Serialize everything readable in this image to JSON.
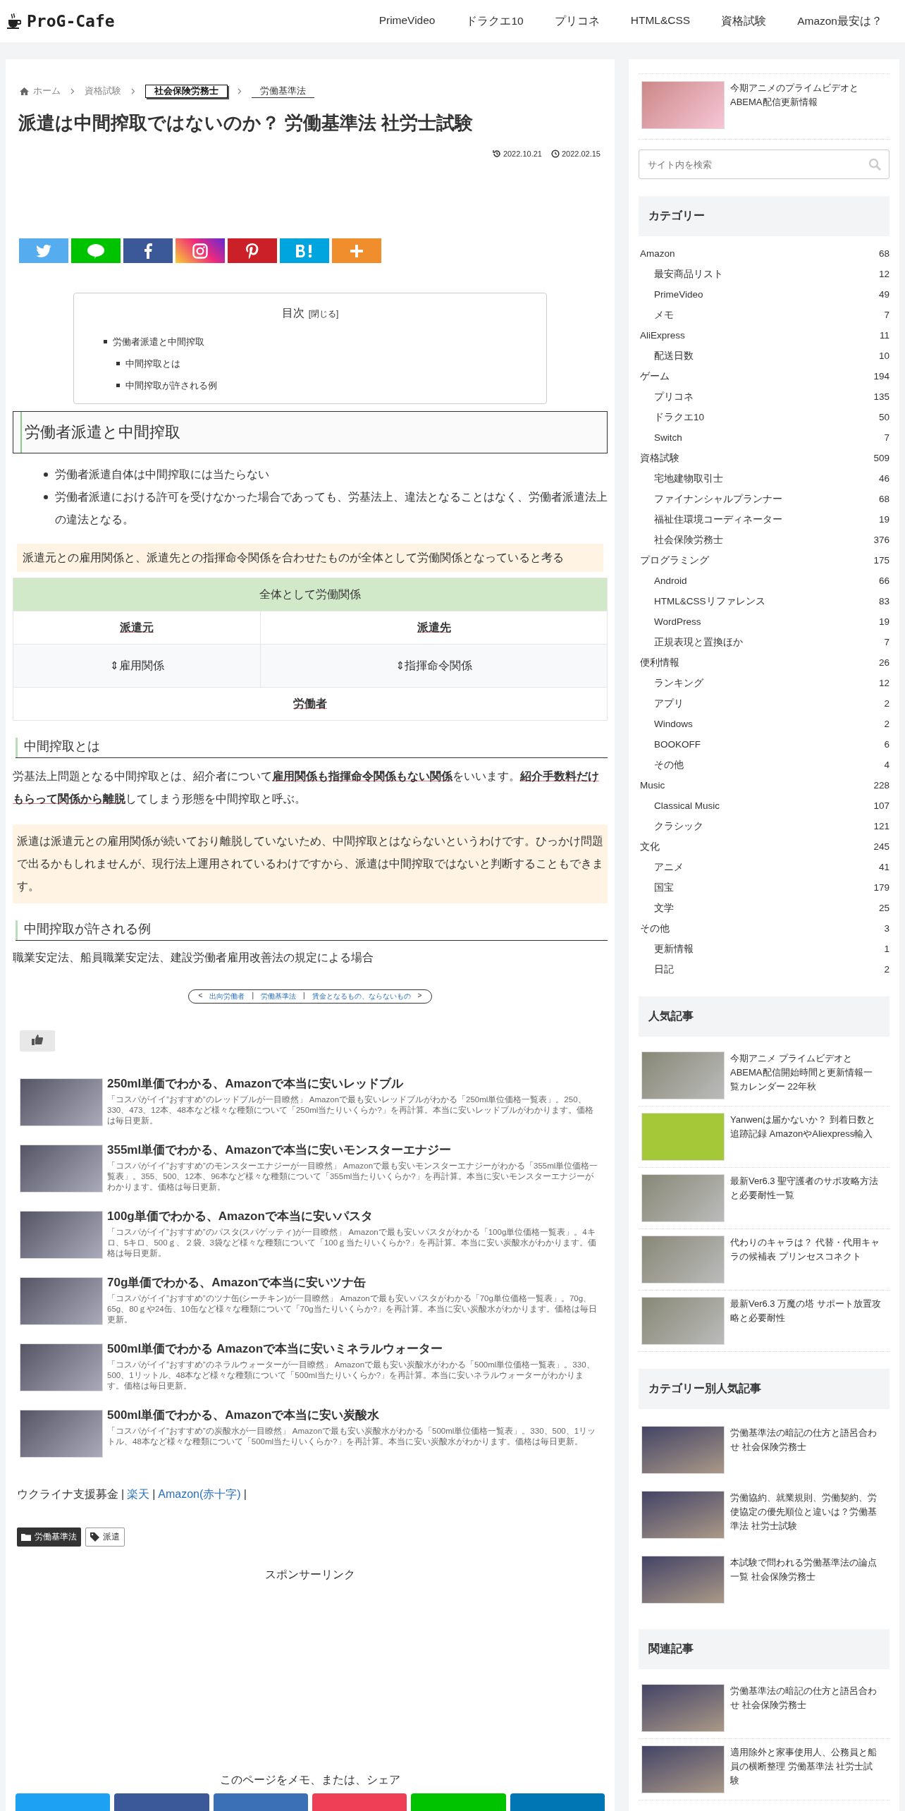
{
  "header": {
    "logo": "ProG-Cafe",
    "nav": [
      "PrimeVideo",
      "ドラクエ10",
      "プリコネ",
      "HTML&CSS",
      "資格試験",
      "Amazon最安は？"
    ]
  },
  "breadcrumb": [
    {
      "label": "ホーム",
      "kind": "home"
    },
    {
      "label": "資格試験",
      "kind": "link"
    },
    {
      "label": "社会保険労務士",
      "kind": "boxed"
    },
    {
      "label": "労働基準法",
      "kind": "current"
    }
  ],
  "article": {
    "title": "派遣は中間搾取ではないのか？ 労働基準法 社労士試験",
    "updated": "2022.10.21",
    "published": "2022.02.15",
    "share": [
      {
        "kind": "twitter"
      },
      {
        "kind": "line"
      },
      {
        "kind": "facebook"
      },
      {
        "kind": "instagram"
      },
      {
        "kind": "pinterest"
      },
      {
        "kind": "hatena"
      },
      {
        "kind": "more"
      }
    ],
    "toc": {
      "title": "目次",
      "toggle": "[閉じる]",
      "items": [
        {
          "label": "労働者派遣と中間搾取",
          "children": [
            {
              "label": "中間搾取とは"
            },
            {
              "label": "中間搾取が許される例"
            }
          ]
        }
      ]
    },
    "h2": "労働者派遣と中間搾取",
    "bullets": [
      "労働者派遣自体は中間搾取には当たらない",
      "労働者派遣における許可を受けなかった場合であっても、労基法上、違法となることはなく、労働者派遣法上の違法となる。"
    ],
    "highlight": "派遣元との雇用関係と、派遣先との指揮命令関係を合わせたものが全体として労働関係となっていると考る",
    "table": {
      "header": "全体として労働関係",
      "parties": [
        "派遣元",
        "派遣先"
      ],
      "relations": [
        "⇕雇用関係",
        "⇕指揮命令関係"
      ],
      "bottom": "労働者"
    },
    "h3a": "中間搾取とは",
    "para1": "労基法上問題となる中間搾取とは、紹介者について**雇用関係も指揮命令関係もない関係**をいいます。**紹介手数料だけもらって関係から離脱**してしまう形態を中間搾取と呼ぶ。",
    "callout": "派遣は派遣元との雇用関係が続いており離脱していないため、中間搾取とはならないというわけです。ひっかけ問題で出るかもしれませんが、現行法上運用されているわけですから、派遣は中間搾取ではないと判断することもできます。",
    "h3b": "中間搾取が許される例",
    "para2": "職業安定法、船員職業安定法、建設労働者雇用改善法の規定による場合",
    "pager": {
      "prev_mark": "<",
      "prev": "出向労働者",
      "sep1": "|",
      "current": "労働基準法",
      "sep2": "|",
      "next": "賃金となるもの、ならないもの",
      "next_mark": ">"
    },
    "related": [
      {
        "title": "250ml単価でわかる、Amazonで本当に安いレッドブル",
        "desc": "「コスパがイイ”おすすめ”のレッドブルが一目瞭然」 Amazonで最も安いレッドブルがわかる「250ml単位価格一覧表」。250、330、473、12本、48本など様々な種類について「250ml当たりいくらか?」を再計算。本当に安いレッドブルがわかります。価格は毎日更新。"
      },
      {
        "title": "355ml単価でわかる、Amazonで本当に安いモンスターエナジー",
        "desc": "「コスパがイイ”おすすめ”のモンスターエナジーが一目瞭然」 Amazonで最も安いモンスターエナジーがわかる「355ml単位価格一覧表」。355、500、12本、96本など様々な種類について「355ml当たりいくらか?」を再計算。本当に安いモンスターエナジーがわかります。価格は毎日更新。"
      },
      {
        "title": "100g単価でわかる、Amazonで本当に安いパスタ",
        "desc": "「コスパがイイ”おすすめ”のパスタ(スパゲッティ)が一目瞭然」 Amazonで最も安いパスタがわかる「100g単位価格一覧表」。4キロ、5キロ、500ｇ、２袋、3袋など様々な種類について「100ｇ当たりいくらか?」を再計算。本当に安い炭酸水がわかります。価格は毎日更新。"
      },
      {
        "title": "70g単価でわかる、Amazonで本当に安いツナ缶",
        "desc": "「コスパがイイ”おすすめ”のツナ缶(シーチキン)が一目瞭然」 Amazonで最も安いパスタがわかる「70g単位価格一覧表」。70g、65g、80ｇや24缶、10缶など様々な種類について「70g当たりいくらか?」を再計算。本当に安い炭酸水がわかります。価格は毎日更新。"
      },
      {
        "title": "500ml単価でわかる Amazonで本当に安いミネラルウォーター",
        "desc": "「コスパがイイ”おすすめ”のネラルウォーターが一目瞭然」 Amazonで最も安い炭酸水がわかる「500ml単位価格一覧表」。330、500、1リットル、48本など様々な種類について「500ml当たりいくらか?」を再計算。本当に安いネラルウォーターがわかります。価格は毎日更新。"
      },
      {
        "title": "500ml単価でわかる、Amazonで本当に安い炭酸水",
        "desc": "「コスパがイイ”おすすめ”の炭酸水が一目瞭然」 Amazonで最も安い炭酸水がわかる「500ml単位価格一覧表」。330、500、1リットル、48本など様々な種類について「500ml当たりいくらか?」を再計算。本当に安い炭酸水がわかります。価格は毎日更新。"
      }
    ],
    "donation": {
      "label": "ウクライナ支援募金",
      "separator": "|",
      "links": [
        "楽天",
        "Amazon(赤十字)"
      ]
    },
    "tags": [
      {
        "label": "労働基準法",
        "kind": "category"
      },
      {
        "label": "派遣",
        "kind": "tag"
      }
    ],
    "sponsor": "スポンサーリンク",
    "share_heading": "このページをメモ、または、シェア",
    "bottom_share": [
      {
        "color": "#1da1f2"
      },
      {
        "color": "#3b5998"
      },
      {
        "color": "#3b6fb6"
      },
      {
        "color": "#ef3f56"
      },
      {
        "color": "#00c300"
      },
      {
        "color": "#0077b5"
      }
    ]
  },
  "sidebar": {
    "top_article": "今期アニメのプライムビデオとABEMA配信更新情報",
    "search": {
      "placeholder": "サイト内を検索"
    },
    "categories_title": "カテゴリー",
    "categories": [
      {
        "label": "Amazon",
        "count": "68",
        "children": [
          {
            "label": "最安商品リスト",
            "count": "12"
          },
          {
            "label": "PrimeVideo",
            "count": "49"
          },
          {
            "label": "メモ",
            "count": "7"
          }
        ]
      },
      {
        "label": "AliExpress",
        "count": "11",
        "children": [
          {
            "label": "配送日数",
            "count": "10"
          }
        ]
      },
      {
        "label": "ゲーム",
        "count": "194",
        "children": [
          {
            "label": "プリコネ",
            "count": "135"
          },
          {
            "label": "ドラクエ10",
            "count": "50"
          },
          {
            "label": "Switch",
            "count": "7"
          }
        ]
      },
      {
        "label": "資格試験",
        "count": "509",
        "children": [
          {
            "label": "宅地建物取引士",
            "count": "46"
          },
          {
            "label": "ファイナンシャルプランナー",
            "count": "68"
          },
          {
            "label": "福祉住環境コーディネーター",
            "count": "19"
          },
          {
            "label": "社会保険労務士",
            "count": "376"
          }
        ]
      },
      {
        "label": "プログラミング",
        "count": "175",
        "children": [
          {
            "label": "Android",
            "count": "66"
          },
          {
            "label": "HTML&CSSリファレンス",
            "count": "83"
          },
          {
            "label": "WordPress",
            "count": "19"
          },
          {
            "label": "正規表現と置換ほか",
            "count": "7"
          }
        ]
      },
      {
        "label": "便利情報",
        "count": "26",
        "children": [
          {
            "label": "ランキング",
            "count": "12"
          },
          {
            "label": "アプリ",
            "count": "2"
          },
          {
            "label": "Windows",
            "count": "2"
          },
          {
            "label": "BOOKOFF",
            "count": "6"
          },
          {
            "label": "その他",
            "count": "4"
          }
        ]
      },
      {
        "label": "Music",
        "count": "228",
        "children": [
          {
            "label": "Classical Music",
            "count": "107"
          },
          {
            "label": "クラシック",
            "count": "121"
          }
        ]
      },
      {
        "label": "文化",
        "count": "245",
        "children": [
          {
            "label": "アニメ",
            "count": "41"
          },
          {
            "label": "国宝",
            "count": "179"
          },
          {
            "label": "文学",
            "count": "25"
          }
        ]
      },
      {
        "label": "その他",
        "count": "3",
        "children": [
          {
            "label": "更新情報",
            "count": "1"
          },
          {
            "label": "日記",
            "count": "2"
          }
        ]
      }
    ],
    "popular_title": "人気記事",
    "popular": [
      "今期アニメ プライムビデオとABEMA配信開始時間と更新情報一覧カレンダー 22年秋",
      "Yanwenは届かないか？ 到着日数と追跡記録 AmazonやAliexpress輸入",
      "最新Ver6.3 聖守護者のサポ攻略方法と必要耐性一覧",
      "代わりのキャラは？ 代替・代用キャラの候補表 プリンセスコネクト",
      "最新Ver6.3 万魔の塔 サポート放置攻略と必要耐性"
    ],
    "category_popular_title": "カテゴリー別人気記事",
    "category_popular": [
      "労働基準法の暗記の仕方と語呂合わせ 社会保険労務士",
      "労働協約、就業規則、労働契約、労使協定の優先順位と違いは？労働基準法 社労士試験",
      "本試験で問われる労働基準法の論点一覧 社会保険労務士"
    ],
    "related_title": "関連記事",
    "related": [
      "労働基準法の暗記の仕方と語呂合わせ 社会保険労務士",
      "適用除外と家事使用人、公務員と船員の横断整理 労働基準法 社労士試験"
    ]
  }
}
